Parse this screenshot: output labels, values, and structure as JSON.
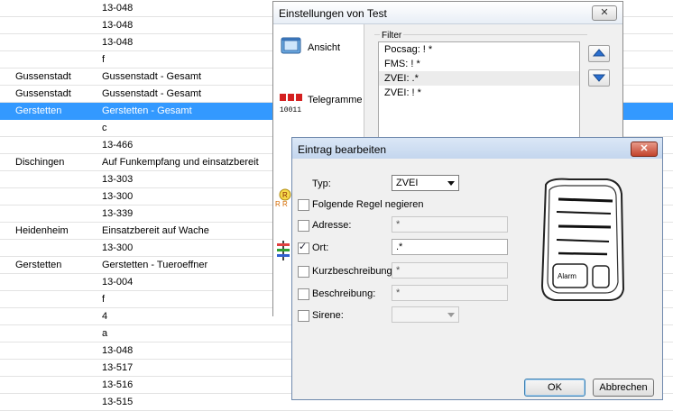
{
  "rows": [
    {
      "c1": "",
      "c2": "13-048"
    },
    {
      "c1": "",
      "c2": "13-048"
    },
    {
      "c1": "",
      "c2": "13-048"
    },
    {
      "c1": "",
      "c2": "f"
    },
    {
      "c1": "Gussenstadt",
      "c2": "Gussenstadt - Gesamt"
    },
    {
      "c1": "Gussenstadt",
      "c2": "Gussenstadt - Gesamt"
    },
    {
      "c1": "Gerstetten",
      "c2": "Gerstetten - Gesamt",
      "selected": true
    },
    {
      "c1": "",
      "c2": "c"
    },
    {
      "c1": "",
      "c2": "13-466"
    },
    {
      "c1": "Dischingen",
      "c2": "Auf Funkempfang und einsatzbereit"
    },
    {
      "c1": "",
      "c2": "13-303"
    },
    {
      "c1": "",
      "c2": "13-300"
    },
    {
      "c1": "",
      "c2": "13-339"
    },
    {
      "c1": "Heidenheim",
      "c2": "Einsatzbereit auf Wache"
    },
    {
      "c1": "",
      "c2": "13-300"
    },
    {
      "c1": "Gerstetten",
      "c2": "Gerstetten - Tueroeffner"
    },
    {
      "c1": "",
      "c2": "13-004"
    },
    {
      "c1": "",
      "c2": "f"
    },
    {
      "c1": "",
      "c2": "4"
    },
    {
      "c1": "",
      "c2": "a"
    },
    {
      "c1": "",
      "c2": "13-048"
    },
    {
      "c1": "",
      "c2": "13-517"
    },
    {
      "c1": "",
      "c2": "13-516"
    },
    {
      "c1": "",
      "c2": "13-515"
    }
  ],
  "settings": {
    "title": "Einstellungen von Test",
    "close": "✕",
    "nav": [
      {
        "label": "Ansicht",
        "icon": "view-window-icon"
      },
      {
        "label": "Telegramme",
        "icon": "telegram-icon"
      }
    ],
    "filter_label": "Filter",
    "filters": [
      "Pocsag: ! *",
      "FMS: ! *",
      "ZVEI: .*",
      "ZVEI: ! *"
    ],
    "highlighted_filter": 2
  },
  "dialog": {
    "title": "Eintrag bearbeiten",
    "close": "✕",
    "typ_label": "Typ:",
    "typ_value": "ZVEI",
    "negate_label": "Folgende Regel negieren",
    "fields": [
      {
        "label": "Adresse:",
        "value": "*",
        "checked": false,
        "enabled": false
      },
      {
        "label": "Ort:",
        "value": ".*",
        "checked": true,
        "enabled": true
      },
      {
        "label": "Kurzbeschreibung:",
        "value": "*",
        "checked": false,
        "enabled": false
      },
      {
        "label": "Beschreibung:",
        "value": "*",
        "checked": false,
        "enabled": false
      }
    ],
    "sirene_label": "Sirene:",
    "sirene_value": "",
    "pager_button_label": "Alarm",
    "ok_label": "OK",
    "cancel_label": "Abbrechen"
  },
  "colors": {
    "selection": "#3399ff",
    "dialog_title": "#c4d6ee",
    "close_red": "#c2432c"
  }
}
